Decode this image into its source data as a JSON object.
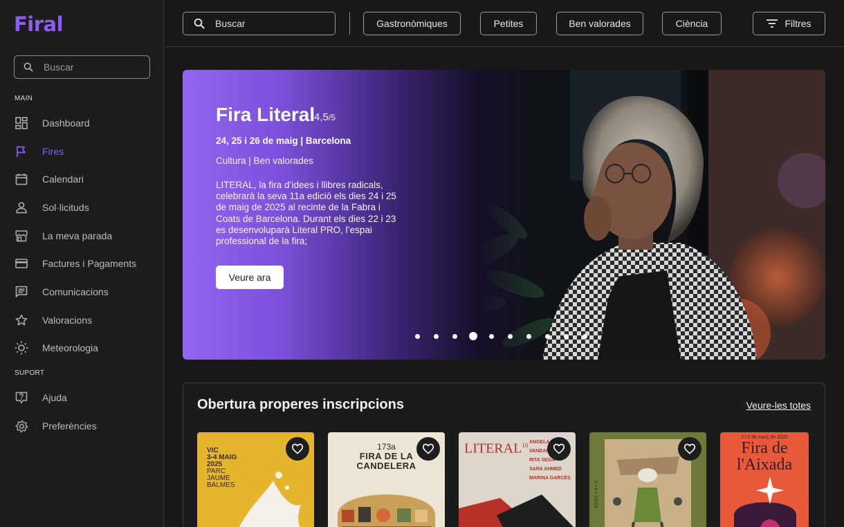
{
  "app": {
    "logo": "Firal"
  },
  "sidebar": {
    "search_placeholder": "Buscar",
    "sections": {
      "main": "MAIN",
      "support": "SUPORT"
    },
    "items": [
      {
        "label": "Dashboard",
        "icon": "dashboard-icon"
      },
      {
        "label": "Fires",
        "icon": "flag-icon",
        "active": true
      },
      {
        "label": "Calendari",
        "icon": "calendar-icon"
      },
      {
        "label": "Sol·licituds",
        "icon": "person-icon"
      },
      {
        "label": "La meva parada",
        "icon": "store-icon"
      },
      {
        "label": "Factures i Pagaments",
        "icon": "credit-card-icon"
      },
      {
        "label": "Comunicacions",
        "icon": "message-icon"
      },
      {
        "label": "Valoracions",
        "icon": "star-icon"
      },
      {
        "label": "Meteorologia",
        "icon": "sun-icon"
      }
    ],
    "support_items": [
      {
        "label": "Ajuda",
        "icon": "help-icon"
      },
      {
        "label": "Preferències",
        "icon": "settings-icon"
      }
    ]
  },
  "topbar": {
    "search_placeholder": "Buscar",
    "chips": [
      "Gastronòmiques",
      "Petites",
      "Ben valorades",
      "Ciència"
    ],
    "filters_label": "Filtres"
  },
  "hero": {
    "title": "Fira Literal",
    "rating": "4,5",
    "rating_max": "/5",
    "date_location": "24, 25 i 26 de maig | Barcelona",
    "tags": "Cultura | Ben valorades",
    "description": "LITERAL, la fira d’idees i llibres radicals, celebrarà la seva 11a edició els dies 24 i 25 de maig de 2025 al recinte de la Fabra i Coats de Barcelona. Durant els dies 22 i 23 es desenvoluparà Literal PRO, l’espai professional de la fira;",
    "cta": "Veure ara",
    "slides_total": 10,
    "slide_active": 4
  },
  "upcoming": {
    "title": "Obertura properes inscripcions",
    "see_all": "Veure-les totes",
    "cards": [
      {
        "poster_lines": [
          "VIC",
          "3-4 MAIG",
          "2025",
          "PARC",
          "JAUME",
          "BALMES"
        ],
        "bg": "#e6b52e"
      },
      {
        "poster_lines": [
          "173a",
          "FIRA DE LA",
          "CANDELERA"
        ],
        "bg": "#ece4d4"
      },
      {
        "poster_lines": [
          "LITERAL",
          "10",
          "ANGELA D",
          "VANDAN",
          "RITA SEGA",
          "SARA AHMED",
          "MARINA GARCÉS"
        ],
        "bg": "#ddd6cc"
      },
      {
        "poster_lines": [
          "5 • 6 • 7/4/24"
        ],
        "bg": "#6f7a3a"
      },
      {
        "poster_lines": [
          "1 i 2 de març de 2025",
          "Fira de",
          "l'Aixada"
        ],
        "bg": "#e8593a"
      }
    ]
  }
}
